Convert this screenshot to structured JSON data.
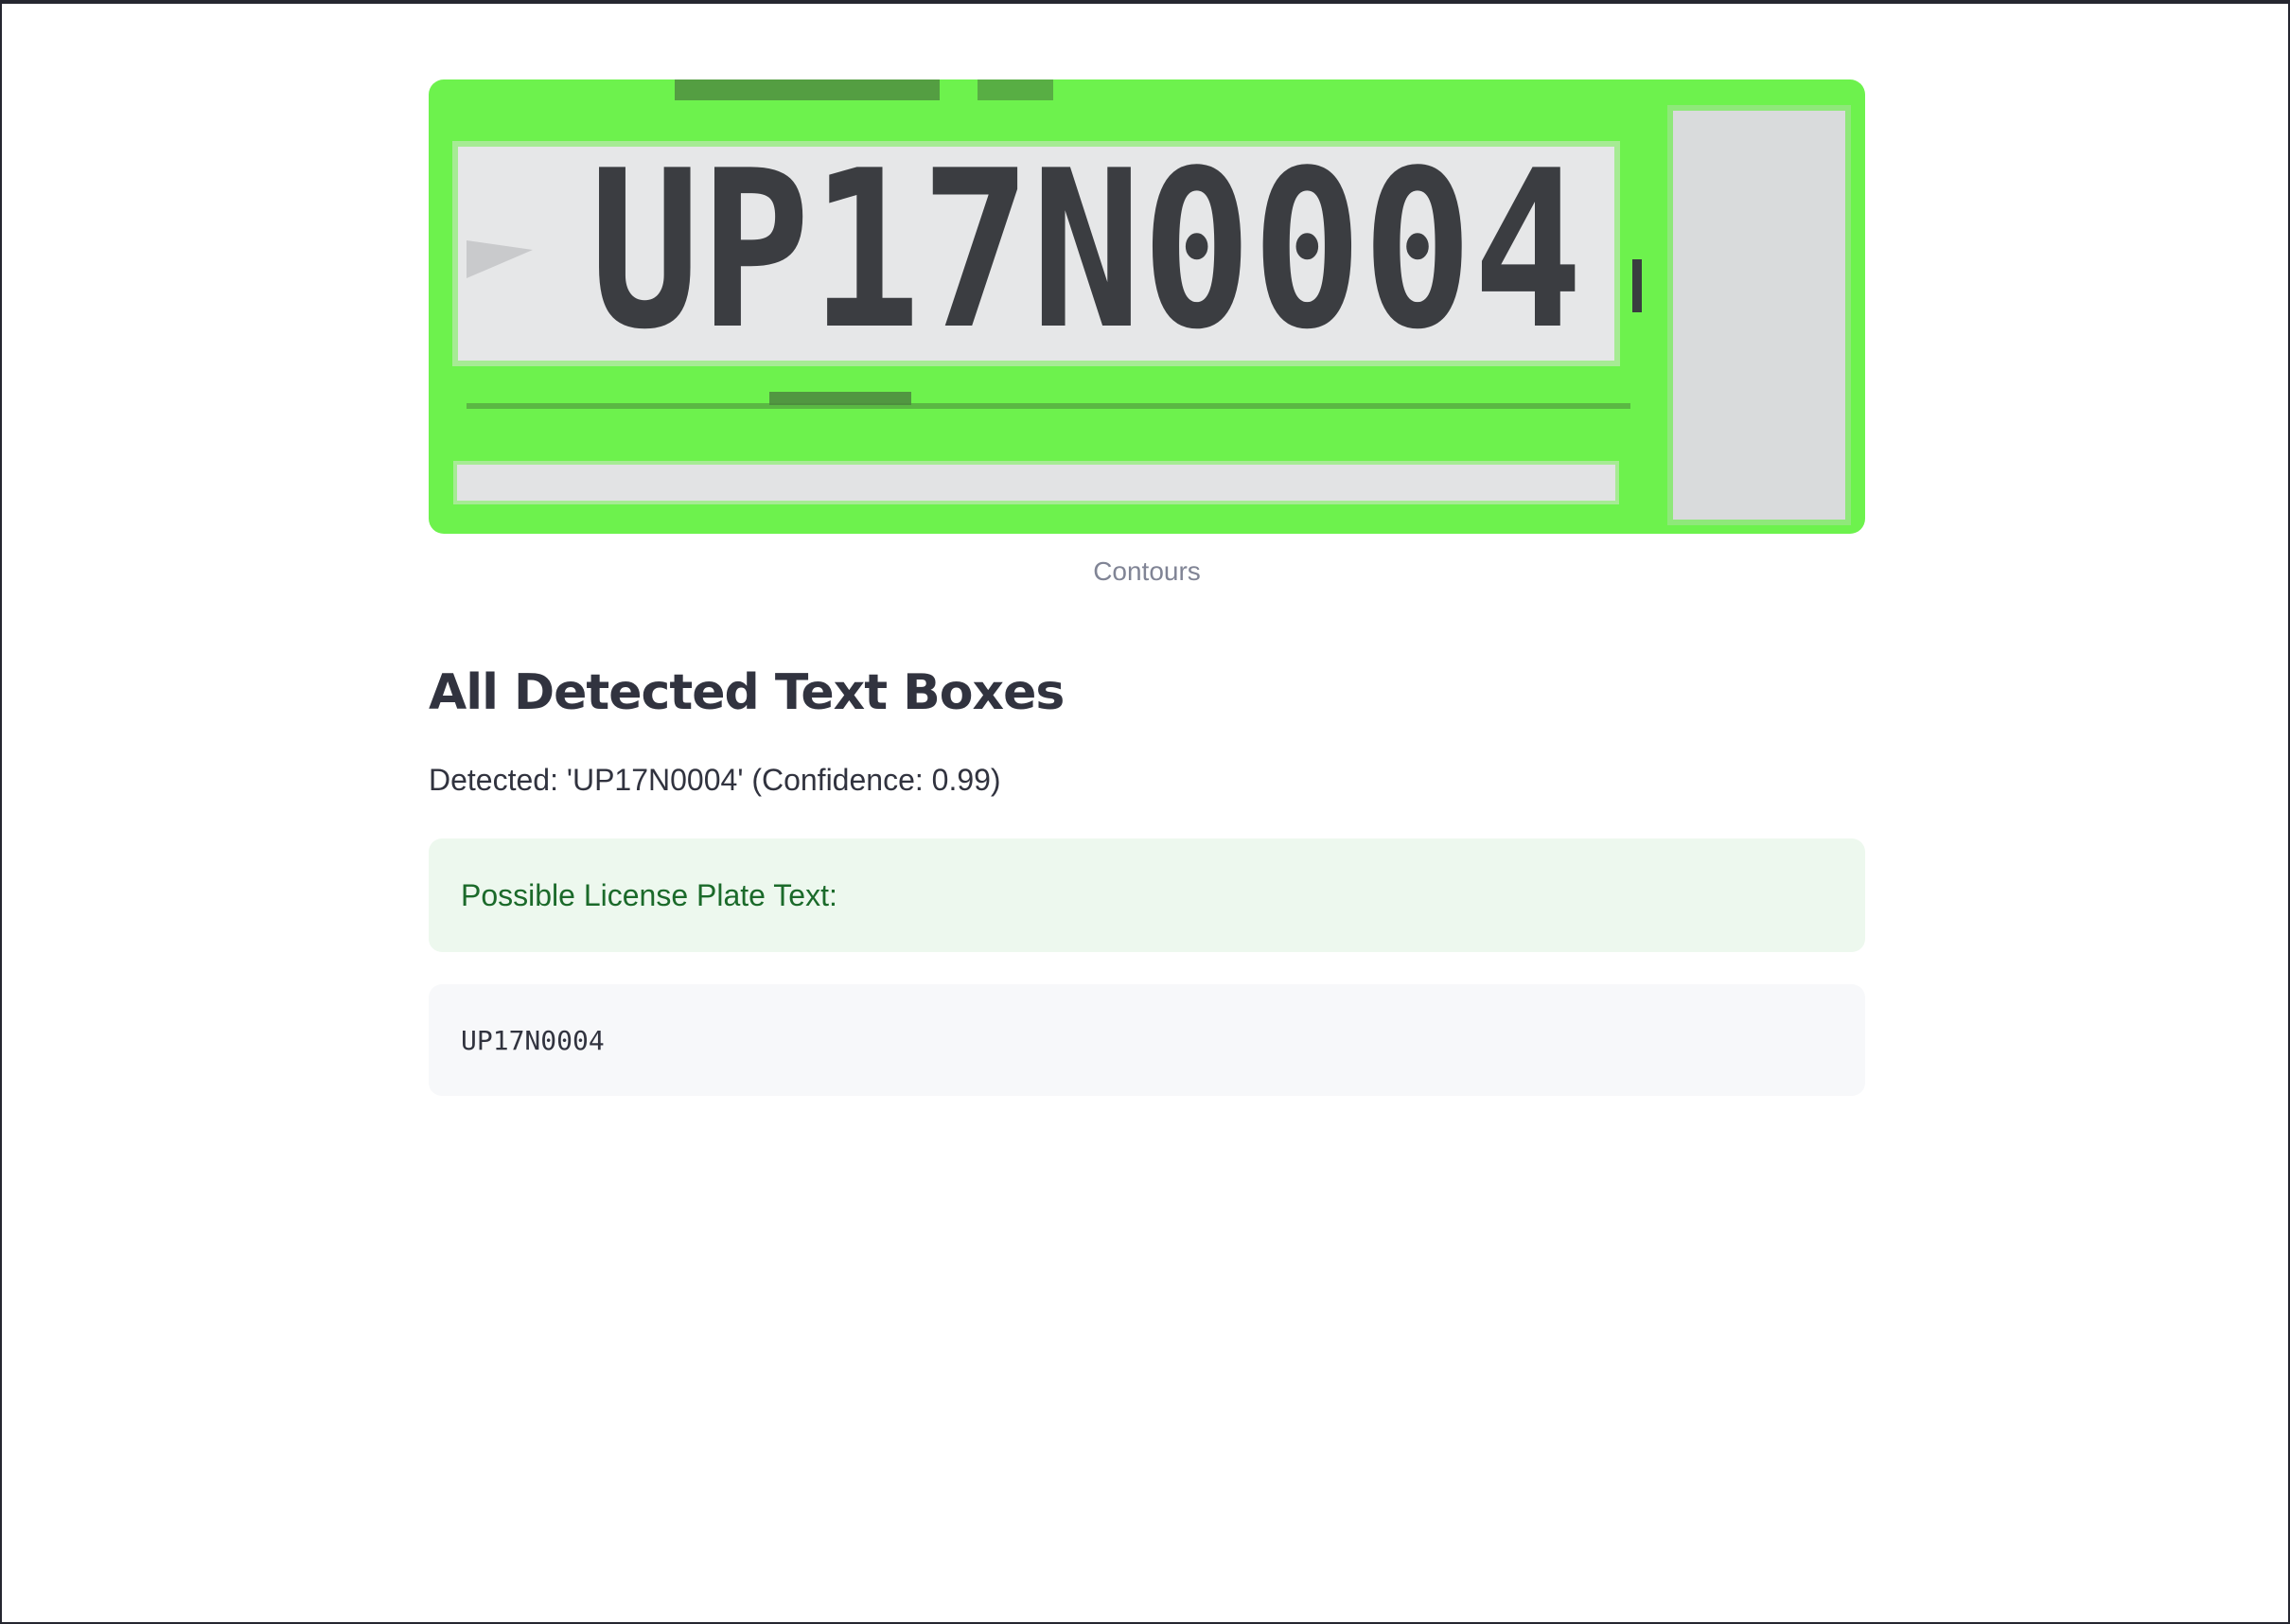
{
  "image": {
    "plate_text": "UP17N0004",
    "caption": "Contours",
    "contour_color": "#6df24d"
  },
  "heading": "All Detected Text Boxes",
  "detected_line": "Detected: 'UP17N0004' (Confidence: 0.99)",
  "success": {
    "message": "Possible License Plate Text:",
    "color": "#1b6a2a",
    "background": "#edf8ee"
  },
  "code": {
    "value": "UP17N0004"
  }
}
